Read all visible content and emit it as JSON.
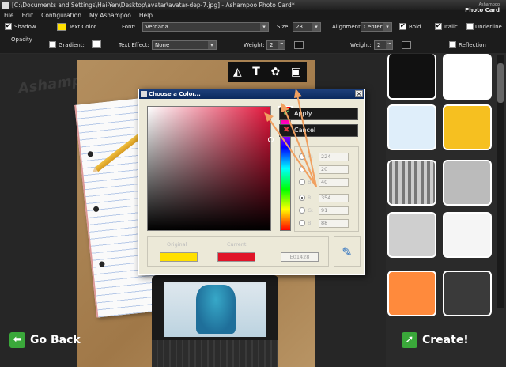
{
  "window": {
    "title": "[C:\\Documents and Settings\\Hai-Yen\\Desktop\\avatar\\avatar-dep-7.jpg] - Ashampoo Photo Card*",
    "brand_line1": "Ashampoo",
    "brand_line2": "Photo Card"
  },
  "menu": [
    "File",
    "Edit",
    "Configuration",
    "My Ashampoo",
    "Help"
  ],
  "toolbar": {
    "shadow_label": "Shadow",
    "text_color_label": "Text Color",
    "font_label": "Font:",
    "font_value": "Verdana",
    "size_label": "Size:",
    "size_value": "23",
    "alignment_label": "Alignment:",
    "alignment_value": "Center",
    "bold_label": "Bold",
    "italic_label": "Italic",
    "underline_label": "Underline",
    "opacity_label": "Opacity",
    "gradient_label": "Gradient:",
    "text_effect_label": "Text Effect:",
    "text_effect_value": "None",
    "weight_label": "Weight:",
    "weight1_value": "2",
    "weight2_value": "2",
    "reflection_label": "Reflection",
    "text_color": "#ffe000"
  },
  "stage": {
    "watermark": "Ashampoo PHOTO C",
    "go_back": "Go Back",
    "create": "Create!"
  },
  "dialog": {
    "title": "Choose a Color...",
    "apply": "Apply",
    "cancel": "Cancel",
    "fields": [
      {
        "label": "H:",
        "value": "224",
        "selected": false
      },
      {
        "label": "S:",
        "value": "20",
        "selected": false
      },
      {
        "label": "B:",
        "value": "40",
        "selected": false
      },
      {
        "label": "R:",
        "value": "354",
        "selected": true
      },
      {
        "label": "G:",
        "value": "91",
        "selected": false
      },
      {
        "label": "B:",
        "value": "88",
        "selected": false
      }
    ],
    "original_label": "Original",
    "current_label": "Current",
    "hex_value": "E01428",
    "original_color": "#ffe000",
    "current_color": "#e01428"
  }
}
